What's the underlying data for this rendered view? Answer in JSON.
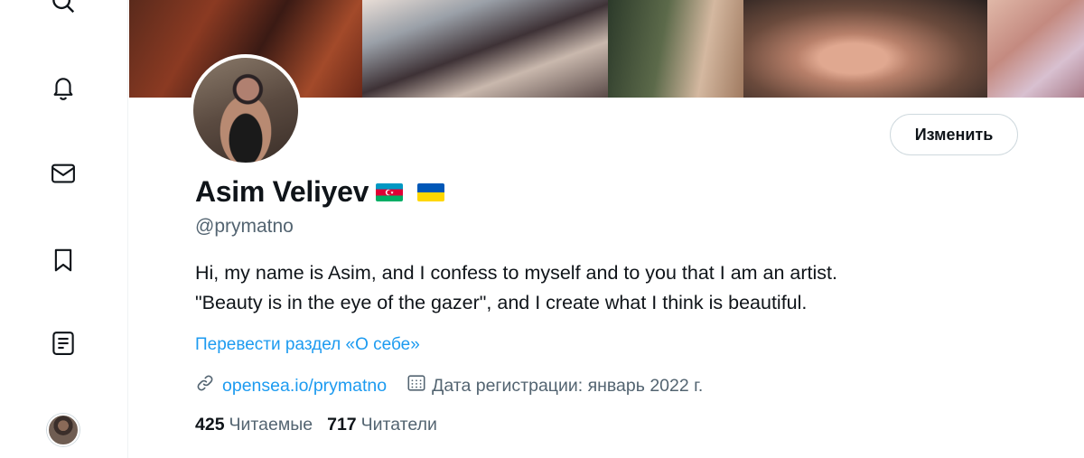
{
  "nav": {
    "items": [
      {
        "name": "search",
        "icon": "search-icon"
      },
      {
        "name": "notifications",
        "icon": "bell-icon"
      },
      {
        "name": "messages",
        "icon": "mail-icon"
      },
      {
        "name": "bookmarks",
        "icon": "bookmark-icon"
      },
      {
        "name": "lists",
        "icon": "list-icon"
      },
      {
        "name": "profile",
        "icon": "avatar"
      }
    ]
  },
  "profile": {
    "edit_label": "Изменить",
    "display_name": "Asim Veliyev",
    "flags": [
      "azerbaijan-flag",
      "ukraine-flag"
    ],
    "handle": "@prymatno",
    "bio_line1": "Hi, my name is Asim, and I confess to myself and to you that I am an artist.",
    "bio_line2": "\"Beauty is in the eye of the gazer\", and I create what I think is beautiful.",
    "translate_label": "Перевести раздел «О себе»",
    "website": "opensea.io/prymatno",
    "joined": "Дата регистрации: январь 2022 г.",
    "following_count": "425",
    "following_label": "Читаемые",
    "followers_count": "717",
    "followers_label": "Читатели"
  },
  "colors": {
    "accent": "#1d9bf0",
    "text_primary": "#0f1419",
    "text_secondary": "#536471",
    "border": "#cfd9de"
  }
}
